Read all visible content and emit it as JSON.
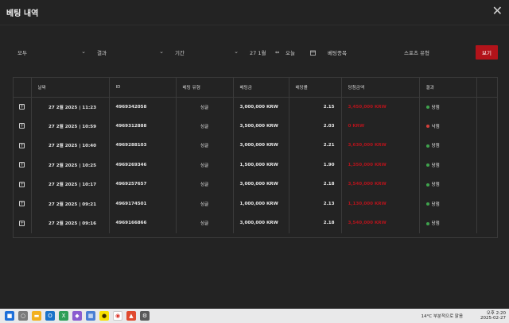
{
  "window": {
    "title": "베팅 내역",
    "close_label": "✕"
  },
  "filters": {
    "all": "모두",
    "result": "결과",
    "period": "기간",
    "date": "27 1월",
    "arrows": "⇔",
    "today": "오늘",
    "calendar_icon": "calendar-icon",
    "bet_type": "베팅종목",
    "sport_type": "스포츠 유형",
    "view_button": "보기"
  },
  "table": {
    "headers": [
      "날짜",
      "ID",
      "베팅 유형",
      "베팅금",
      "배당률",
      "당첨금액",
      "결과"
    ],
    "rows": [
      {
        "date": "27 2월 2025 | 11:23",
        "id": "4969342058",
        "type": "싱글",
        "stake": "3,000,000 KRW",
        "odds": "2.15",
        "win": "3,450,000 KRW",
        "result": "당첨",
        "status": "win"
      },
      {
        "date": "27 2월 2025 | 10:59",
        "id": "4969312888",
        "type": "싱글",
        "stake": "3,500,000 KRW",
        "odds": "2.03",
        "win": "0 KRW",
        "result": "낙첨",
        "status": "loss"
      },
      {
        "date": "27 2월 2025 | 10:40",
        "id": "4969288103",
        "type": "싱글",
        "stake": "3,000,000 KRW",
        "odds": "2.21",
        "win": "3,630,000 KRW",
        "result": "당첨",
        "status": "win"
      },
      {
        "date": "27 2월 2025 | 10:25",
        "id": "4969269346",
        "type": "싱글",
        "stake": "1,500,000 KRW",
        "odds": "1.90",
        "win": "1,350,000 KRW",
        "result": "당첨",
        "status": "win"
      },
      {
        "date": "27 2월 2025 | 10:17",
        "id": "4969257657",
        "type": "싱글",
        "stake": "3,000,000 KRW",
        "odds": "2.18",
        "win": "3,540,000 KRW",
        "result": "당첨",
        "status": "win"
      },
      {
        "date": "27 2월 2025 | 09:21",
        "id": "4969174501",
        "type": "싱글",
        "stake": "1,000,000 KRW",
        "odds": "2.13",
        "win": "1,130,000 KRW",
        "result": "당첨",
        "status": "win"
      },
      {
        "date": "27 2월 2025 | 09:16",
        "id": "4969166866",
        "type": "싱글",
        "stake": "3,000,000 KRW",
        "odds": "2.18",
        "win": "3,540,000 KRW",
        "result": "당첨",
        "status": "win"
      }
    ]
  },
  "taskbar": {
    "weather": "14°C 부분적으로 맑음",
    "time": "오후 2:20",
    "date": "2025-02-27"
  },
  "colors": {
    "accent": "#b2131a",
    "win_dot": "#3fa34d",
    "loss_dot": "#d43f3a"
  }
}
